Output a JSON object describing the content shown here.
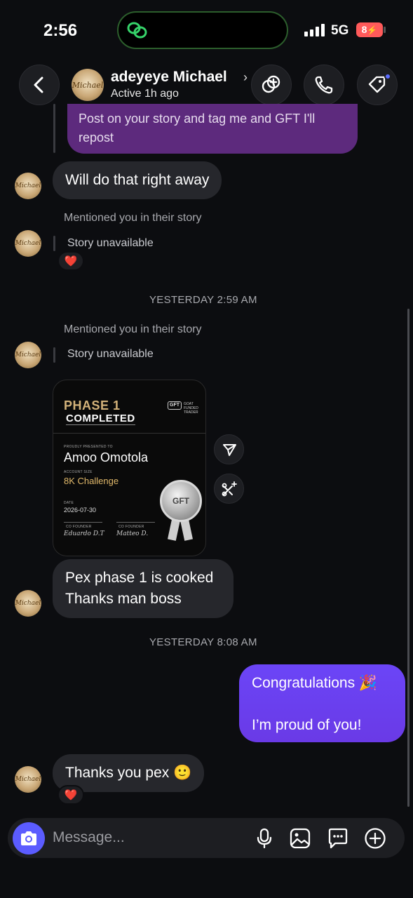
{
  "status": {
    "time": "2:56",
    "network": "5G",
    "battery": "8"
  },
  "header": {
    "name": "adeyeye Michael",
    "status": "Active 1h ago",
    "avatar_text": "Michael"
  },
  "messages": {
    "quoted_reply": "Post on your story and tag me and GFT I'll repost",
    "m1": "Will do that right away",
    "story1_meta": "Mentioned you in their story",
    "story1_text": "Story unavailable",
    "ts1": "YESTERDAY 2:59 AM",
    "story2_meta": "Mentioned you in their story",
    "story2_text": "Story unavailable",
    "m2_line1": "Pex phase 1 is cooked",
    "m2_line2": "Thanks man boss",
    "ts2": "YESTERDAY 8:08 AM",
    "sent_line1": "Congratulations 🎉",
    "sent_line2": "I’m proud of you!",
    "m3": "Thanks you pex 🙂",
    "reaction": "❤️"
  },
  "certificate": {
    "phase": "PHASE 1",
    "status": "COMPLETED",
    "logo_text": "GOAT FUNDED TRADER",
    "logo_mark": "GFT",
    "presented_label": "PROUDLY PRESENTED TO",
    "name": "Amoo Omotola",
    "size_label": "ACCOUNT SIZE",
    "challenge": "8K Challenge",
    "date_label": "DATE",
    "date": "2026-07-30",
    "founder1_label": "CO FOUNDER",
    "founder1_sig": "Eduardo D.T",
    "founder2_label": "CO FOUNDER",
    "founder2_sig": "Matteo D.",
    "medal": "GFT"
  },
  "composer": {
    "placeholder": "Message..."
  },
  "colors": {
    "sent_bubble": "#6a3ef5",
    "received_bubble": "#26272c",
    "quoted_bubble": "#6b2a8a",
    "camera": "#5b5cff"
  },
  "icons": [
    "back-icon",
    "add-people-icon",
    "phone-icon",
    "tag-icon",
    "share-icon",
    "remix-icon",
    "camera-icon",
    "mic-icon",
    "gallery-icon",
    "sticker-icon",
    "plus-icon"
  ]
}
